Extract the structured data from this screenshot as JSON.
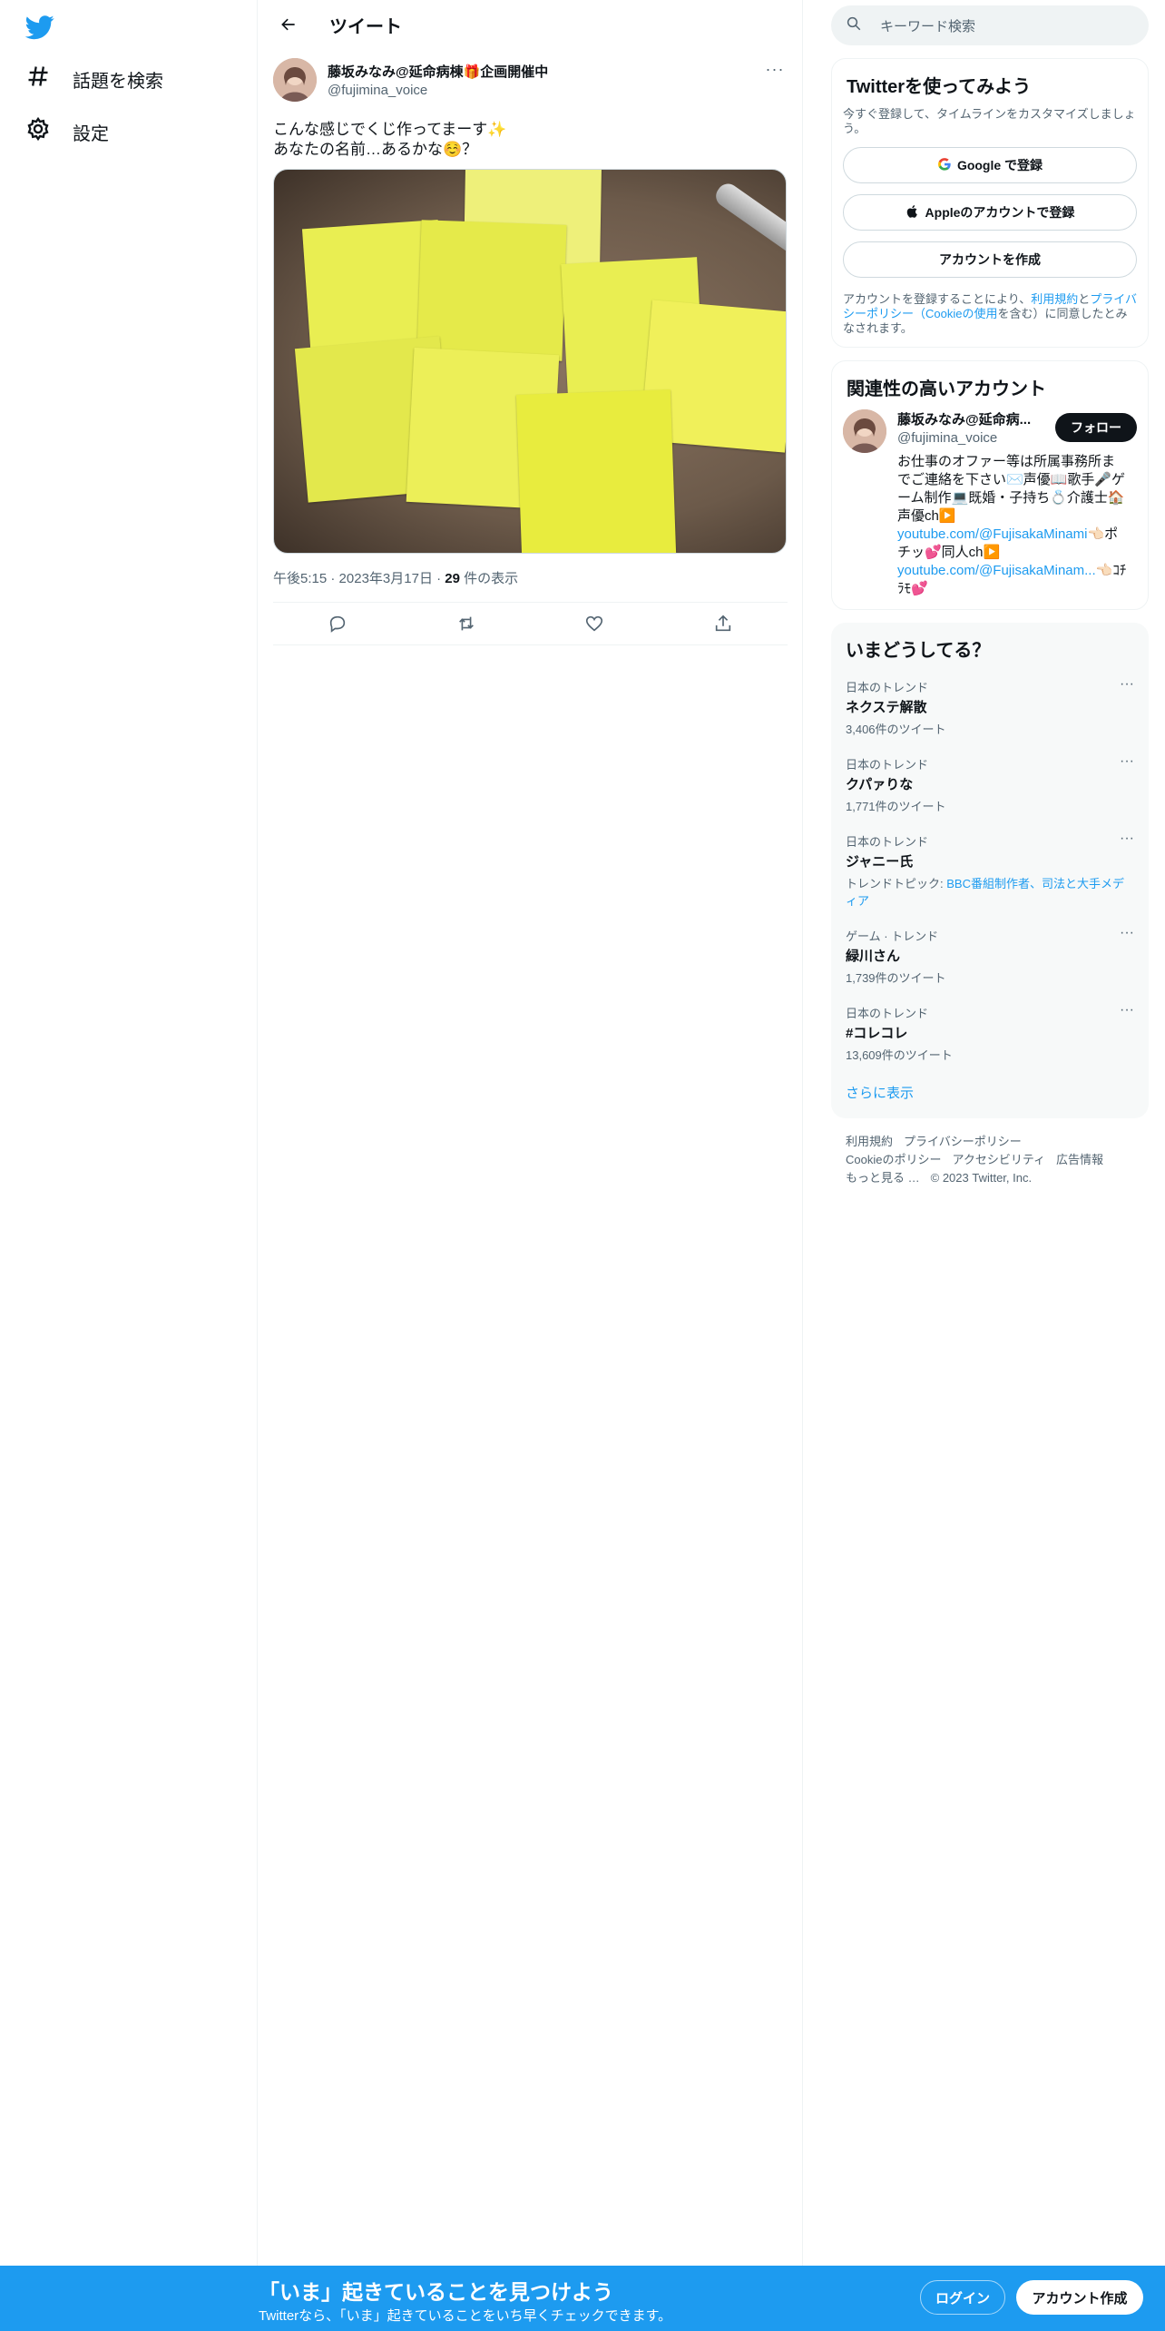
{
  "nav": {
    "explore_label": "話題を検索",
    "settings_label": "設定"
  },
  "header": {
    "title": "ツイート"
  },
  "tweet": {
    "author_name": "藤坂みなみ@延命病棟🎁企画開催中",
    "author_handle": "@fujimina_voice",
    "text": "こんな感じでくじ作ってまーす✨\nあなたの名前…あるかな☺️？",
    "time": "午後5:15",
    "date": "2023年3月17日",
    "views_count": "29",
    "views_label": "件の表示"
  },
  "search": {
    "placeholder": "キーワード検索"
  },
  "signup_card": {
    "title": "Twitterを使ってみよう",
    "subtitle": "今すぐ登録して、タイムラインをカスタマイズしましょう。",
    "google_label": "Google で登録",
    "apple_label": "Appleのアカウントで登録",
    "create_label": "アカウントを作成",
    "legal_prefix": "アカウントを登録することにより、",
    "legal_terms": "利用規約",
    "legal_and": "と",
    "legal_privacy": "プライバシーポリシー（Cookieの使用",
    "legal_suffix": "を含む）に同意したとみなされます。"
  },
  "related": {
    "title": "関連性の高いアカウント",
    "name": "藤坂みなみ@延命病...",
    "handle": "@fujimina_voice",
    "follow_label": "フォロー",
    "bio_1": "お仕事のオファー等は所属事務所までご連絡を下さい✉️声優📖歌手🎤ゲーム制作💻既婚・子持ち💍介護士🏠声優ch▶️",
    "link_1": "youtube.com/@FujisakaMinami",
    "bio_2": "👈🏻ポチッ💕同人ch▶️",
    "link_2": "youtube.com/@FujisakaMinam...",
    "bio_3": "👈🏻ｺﾁﾗﾓ💕"
  },
  "trends": {
    "title": "いまどうしてる？",
    "items": [
      {
        "context": "日本のトレンド",
        "name": "ネクステ解散",
        "count": "3,406件のツイート"
      },
      {
        "context": "日本のトレンド",
        "name": "クパァりな",
        "count": "1,771件のツイート"
      },
      {
        "context": "日本のトレンド",
        "name": "ジャニー氏",
        "topic_prefix": "トレンドトピック: ",
        "topic": "BBC番組制作者、司法と大手メディア"
      },
      {
        "context": "ゲーム · トレンド",
        "name": "緑川さん",
        "count": "1,739件のツイート"
      },
      {
        "context": "日本のトレンド",
        "name": "#コレコレ",
        "count": "13,609件のツイート"
      }
    ],
    "show_more": "さらに表示"
  },
  "footer": {
    "links": [
      "利用規約",
      "プライバシーポリシー",
      "Cookieのポリシー",
      "アクセシビリティ",
      "広告情報",
      "もっと見る …"
    ],
    "copyright": "© 2023 Twitter, Inc."
  },
  "bottom_bar": {
    "title": "「いま」起きていることを見つけよう",
    "subtitle": "Twitterなら、「いま」起きていることをいち早くチェックできます。",
    "login_label": "ログイン",
    "signup_label": "アカウント作成"
  },
  "colors": {
    "accent": "#1d9bf0",
    "text": "#0f1419",
    "secondary": "#536471"
  }
}
